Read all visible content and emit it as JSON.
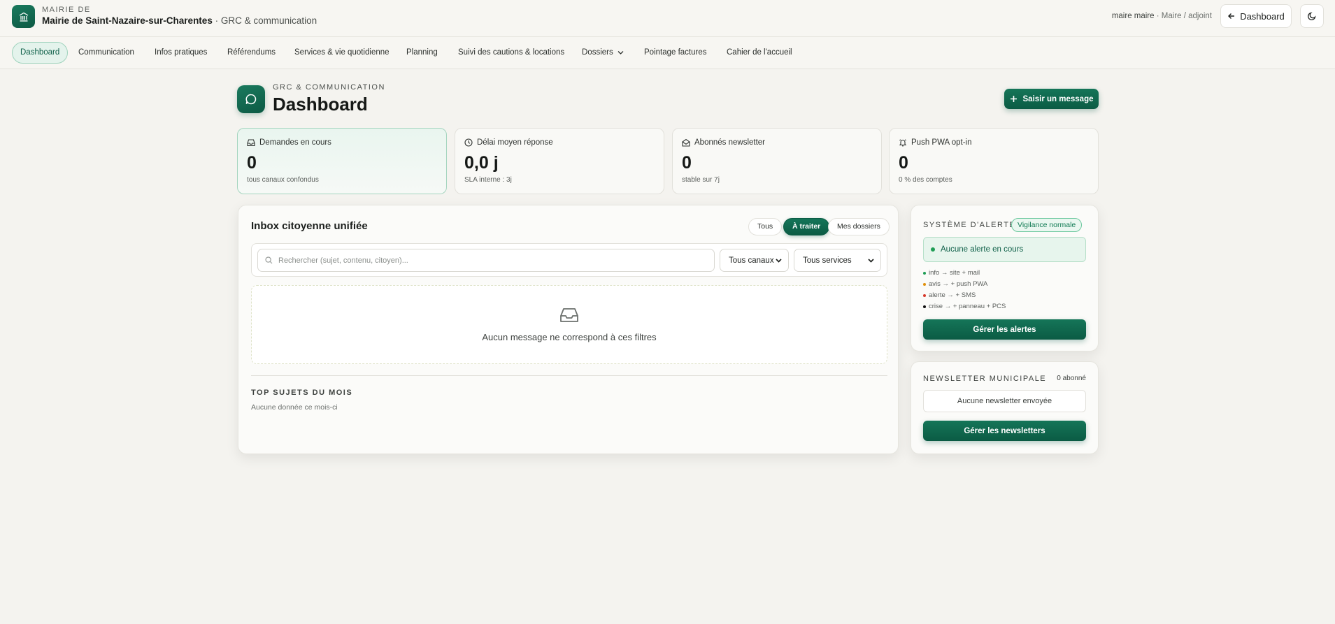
{
  "header": {
    "kicker": "MAIRIE DE",
    "org_name": "Mairie de Saint-Nazaire-sur-Charentes",
    "module_suffix": " · GRC & communication",
    "user_name": "maire maire",
    "user_role": " · Maire / adjoint",
    "back_label": "Dashboard"
  },
  "nav": {
    "items": [
      {
        "label": "Dashboard"
      },
      {
        "label": "Communication"
      },
      {
        "label": "Infos pratiques"
      },
      {
        "label": "Référendums"
      },
      {
        "label": "Services & vie quotidienne"
      },
      {
        "label": "Planning"
      },
      {
        "label": "Suivi des cautions & locations"
      },
      {
        "label": "Dossiers"
      },
      {
        "label": "Pointage factures"
      },
      {
        "label": "Cahier de l'accueil"
      }
    ]
  },
  "page": {
    "kicker": "GRC & COMMUNICATION",
    "title": "Dashboard",
    "primary_action": "Saisir un message"
  },
  "stats": [
    {
      "label": "Demandes en cours",
      "value": "0",
      "note": "tous canaux confondus",
      "icon": "inbox-icon"
    },
    {
      "label": "Délai moyen réponse",
      "value": "0,0 j",
      "note": "SLA interne : 3j",
      "icon": "clock-icon"
    },
    {
      "label": "Abonnés newsletter",
      "value": "0",
      "note": "stable sur 7j",
      "icon": "mail-open-icon"
    },
    {
      "label": "Push PWA opt-in",
      "value": "0",
      "note": "0 % des comptes",
      "icon": "bell-icon"
    }
  ],
  "inbox": {
    "title": "Inbox citoyenne unifiée",
    "filters": {
      "all": "Tous",
      "todo": "À traiter",
      "mine": "Mes dossiers"
    },
    "search_placeholder": "Rechercher (sujet, contenu, citoyen)...",
    "channel_select": "Tous canaux",
    "service_select": "Tous services",
    "empty_text": "Aucun message ne correspond à ces filtres",
    "top_title": "TOP SUJETS DU MOIS",
    "top_empty": "Aucune donnée ce mois-ci"
  },
  "alert": {
    "kicker": "SYSTÈME D'ALERTE",
    "badge": "Vigilance normale",
    "status": "Aucune alerte en cours",
    "levels": [
      {
        "text": "info → site + mail",
        "color": "#1f9d55"
      },
      {
        "text": "avis → + push PWA",
        "color": "#e0900b"
      },
      {
        "text": "alerte → + SMS",
        "color": "#d63a2b"
      },
      {
        "text": "crise → + panneau + PCS",
        "color": "#111111"
      }
    ],
    "manage_label": "Gérer les alertes"
  },
  "newsletter": {
    "kicker": "NEWSLETTER MUNICIPALE",
    "count": "0 abonné",
    "empty": "Aucune newsletter envoyée",
    "manage_label": "Gérer les newsletters"
  }
}
